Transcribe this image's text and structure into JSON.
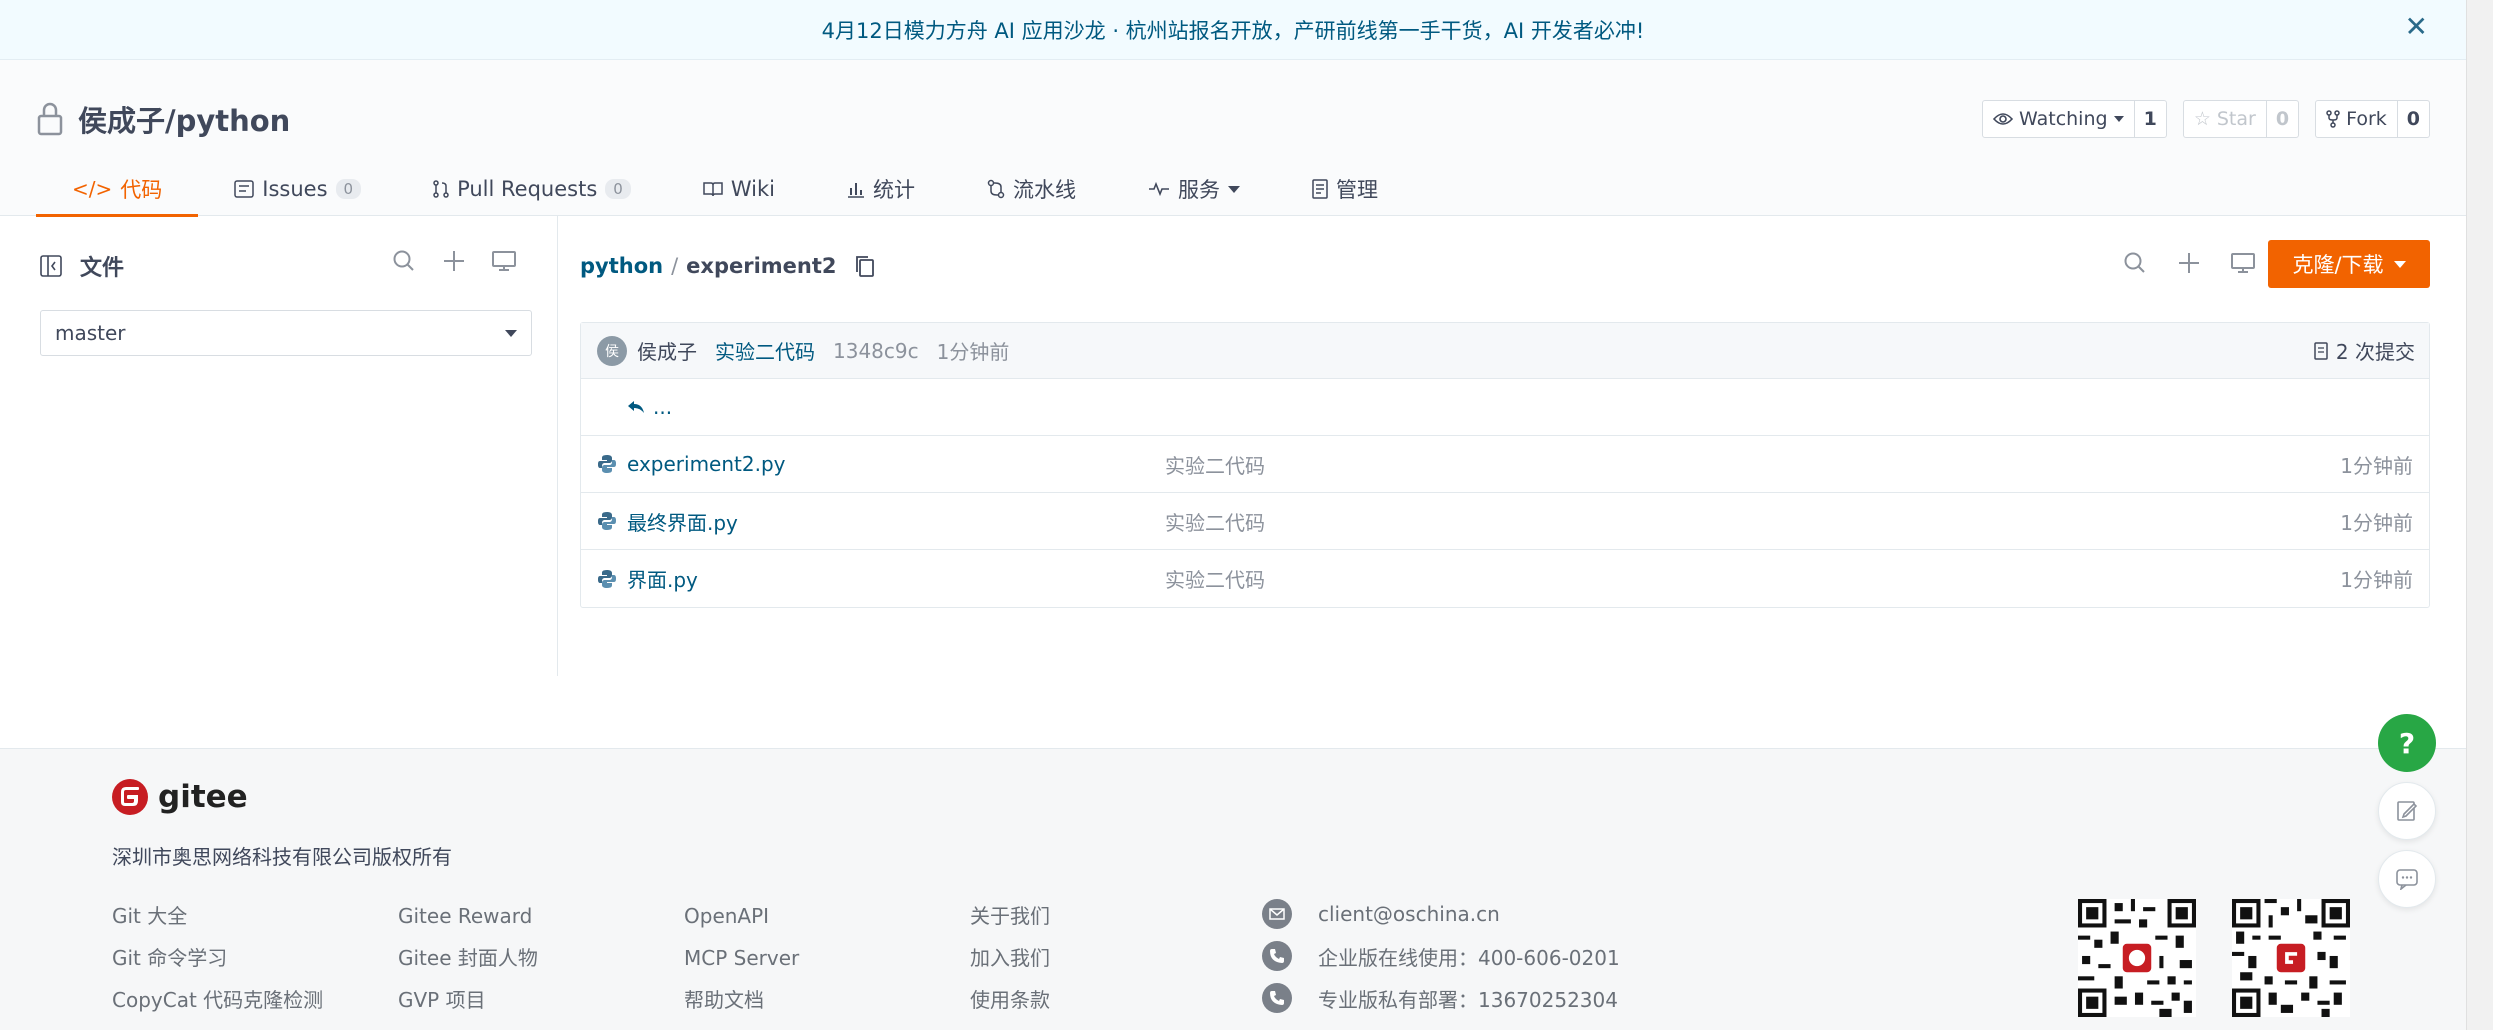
{
  "banner": {
    "text": "4月12日模力方舟 AI 应用沙龙 · 杭州站报名开放，产研前线第一手干货，AI 开发者必冲!",
    "close_label": "✕"
  },
  "repo": {
    "name": "侯成子/python",
    "watch_label": "Watching",
    "watch_count": "1",
    "star_label": "Star",
    "star_count": "0",
    "fork_label": "Fork",
    "fork_count": "0"
  },
  "tabs": [
    {
      "label": "代码",
      "icon": "</>"
    },
    {
      "label": "Issues",
      "badge": "0"
    },
    {
      "label": "Pull Requests",
      "badge": "0"
    },
    {
      "label": "Wiki"
    },
    {
      "label": "统计"
    },
    {
      "label": "流水线"
    },
    {
      "label": "服务"
    },
    {
      "label": "管理"
    }
  ],
  "sidebar": {
    "title": "文件",
    "branch": "master"
  },
  "main": {
    "path_root": "python",
    "path_sep": "/",
    "path_current": "experiment2",
    "clone_label": "克隆/下载"
  },
  "commit": {
    "avatar_text": "侯",
    "author": "侯成子",
    "message": "实验二代码",
    "hash": "1348c9c",
    "time": "1分钟前",
    "count_label": "2 次提交"
  },
  "files": {
    "back_label": "...",
    "items": [
      {
        "name": "experiment2.py",
        "message": "实验二代码",
        "time": "1分钟前"
      },
      {
        "name": "最终界面.py",
        "message": "实验二代码",
        "time": "1分钟前"
      },
      {
        "name": "界面.py",
        "message": "实验二代码",
        "time": "1分钟前"
      }
    ]
  },
  "footer": {
    "logo": "gitee",
    "copyright": "深圳市奥思网络科技有限公司版权所有",
    "col1": [
      "Git 大全",
      "Git 命令学习",
      "CopyCat 代码克隆检测"
    ],
    "col2": [
      "Gitee Reward",
      "Gitee 封面人物",
      "GVP 项目"
    ],
    "col3": [
      "OpenAPI",
      "MCP Server",
      "帮助文档"
    ],
    "col4": [
      "关于我们",
      "加入我们",
      "使用条款"
    ],
    "contact": [
      "client@oschina.cn",
      "企业版在线使用：400-606-0201",
      "专业版私有部署：13670252304"
    ]
  },
  "float": {
    "help": "?"
  },
  "colors": {
    "accent": "#f26300",
    "link": "#005980",
    "help": "#28a745"
  }
}
